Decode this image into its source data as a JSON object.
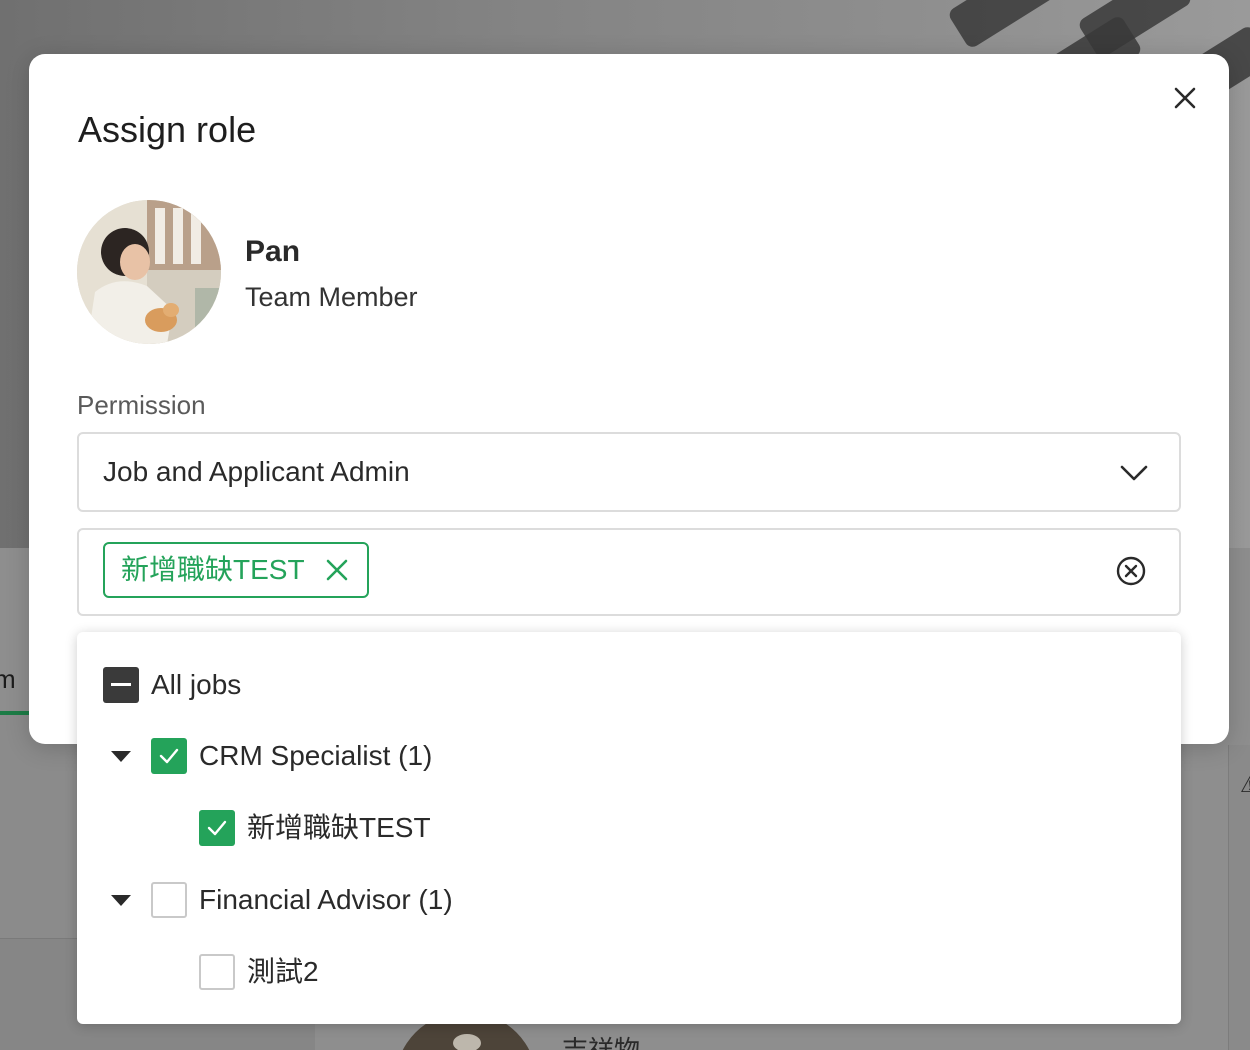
{
  "modal": {
    "title": "Assign role"
  },
  "user": {
    "name": "Pan",
    "role": "Team Member"
  },
  "permission": {
    "label": "Permission",
    "selected": "Job and Applicant Admin"
  },
  "selected_jobs": [
    {
      "label": "新增職缺TEST"
    }
  ],
  "job_tree": {
    "all_label": "All jobs",
    "all_state": "indeterminate",
    "groups": [
      {
        "label": "CRM Specialist (1)",
        "checked": true,
        "expanded": true,
        "jobs": [
          {
            "label": "新增職缺TEST",
            "checked": true
          }
        ]
      },
      {
        "label": "Financial Advisor (1)",
        "checked": false,
        "expanded": true,
        "jobs": [
          {
            "label": "測試2",
            "checked": false
          }
        ]
      }
    ]
  },
  "background": {
    "tab_fragment": "m",
    "bottom_text": "吉祥物"
  },
  "colors": {
    "accent_green": "#24a35a",
    "checkbox_dark": "#3a3a3a",
    "overlay": "#8a8a8a"
  },
  "icons": {
    "close": "close-icon",
    "dropdown": "chevron-down-icon",
    "chip_remove": "close-icon",
    "clear": "circle-x-icon",
    "expand": "caret-down-icon",
    "check": "check-icon",
    "indeterminate": "minus-icon"
  }
}
